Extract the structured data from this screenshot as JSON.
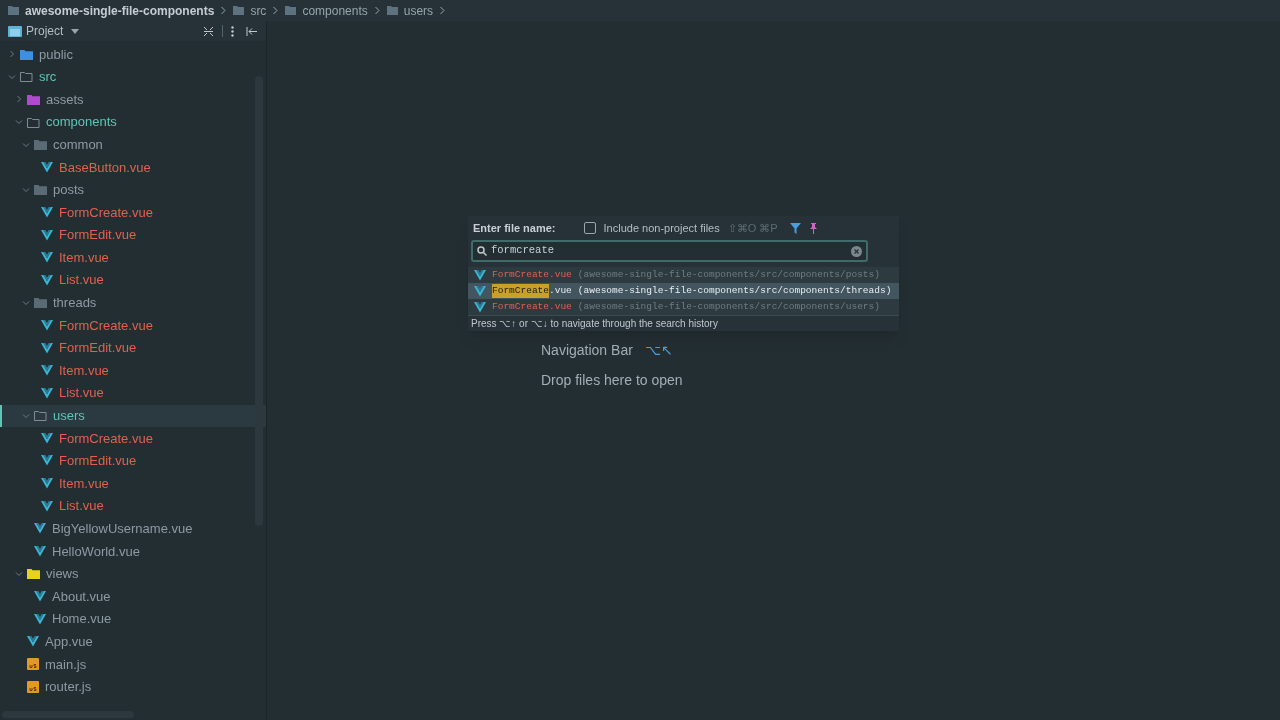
{
  "breadcrumb": [
    {
      "label": "awesome-single-file-components",
      "bold": true
    },
    {
      "label": "src",
      "bold": false
    },
    {
      "label": "components",
      "bold": false
    },
    {
      "label": "users",
      "bold": false
    }
  ],
  "panel": {
    "title": "Project"
  },
  "tree": [
    {
      "kind": "folder",
      "name": "public",
      "color": "#3d8fe0",
      "expanded": false,
      "current": false,
      "selected": false
    },
    {
      "kind": "folder",
      "name": "src",
      "expanded": true,
      "current": true,
      "selected": false,
      "children": [
        {
          "kind": "folder",
          "name": "assets",
          "color": "#b04bd0",
          "expanded": false,
          "current": false,
          "selected": false
        },
        {
          "kind": "folder",
          "name": "components",
          "expanded": true,
          "current": true,
          "selected": false,
          "children": [
            {
              "kind": "folder",
              "name": "common",
              "color": "#5b6b75",
              "expanded": true,
              "current": false,
              "selected": false,
              "children": [
                {
                  "kind": "vue",
                  "name": "BaseButton.vue",
                  "modified": true
                }
              ]
            },
            {
              "kind": "folder",
              "name": "posts",
              "color": "#5b6b75",
              "expanded": true,
              "current": false,
              "selected": false,
              "children": [
                {
                  "kind": "vue",
                  "name": "FormCreate.vue",
                  "modified": true
                },
                {
                  "kind": "vue",
                  "name": "FormEdit.vue",
                  "modified": true
                },
                {
                  "kind": "vue",
                  "name": "Item.vue",
                  "modified": true
                },
                {
                  "kind": "vue",
                  "name": "List.vue",
                  "modified": true
                }
              ]
            },
            {
              "kind": "folder",
              "name": "threads",
              "color": "#5b6b75",
              "expanded": true,
              "current": false,
              "selected": false,
              "children": [
                {
                  "kind": "vue",
                  "name": "FormCreate.vue",
                  "modified": true
                },
                {
                  "kind": "vue",
                  "name": "FormEdit.vue",
                  "modified": true
                },
                {
                  "kind": "vue",
                  "name": "Item.vue",
                  "modified": true
                },
                {
                  "kind": "vue",
                  "name": "List.vue",
                  "modified": true
                }
              ]
            },
            {
              "kind": "folder",
              "name": "users",
              "expanded": true,
              "current": true,
              "selected": true,
              "children": [
                {
                  "kind": "vue",
                  "name": "FormCreate.vue",
                  "modified": true
                },
                {
                  "kind": "vue",
                  "name": "FormEdit.vue",
                  "modified": true
                },
                {
                  "kind": "vue",
                  "name": "Item.vue",
                  "modified": true
                },
                {
                  "kind": "vue",
                  "name": "List.vue",
                  "modified": true
                }
              ]
            },
            {
              "kind": "vue",
              "name": "BigYellowUsername.vue",
              "modified": false
            },
            {
              "kind": "vue",
              "name": "HelloWorld.vue",
              "modified": false
            }
          ]
        },
        {
          "kind": "folder",
          "name": "views",
          "color": "#e8d21a",
          "expanded": true,
          "current": false,
          "selected": false,
          "children": [
            {
              "kind": "vue",
              "name": "About.vue",
              "modified": false
            },
            {
              "kind": "vue",
              "name": "Home.vue",
              "modified": false
            }
          ]
        },
        {
          "kind": "vue",
          "name": "App.vue",
          "modified": false
        },
        {
          "kind": "js",
          "name": "main.js",
          "modified": false
        },
        {
          "kind": "js",
          "name": "router.js",
          "modified": false
        }
      ]
    }
  ],
  "hints": [
    {
      "label": "Navigation Bar",
      "shortcut": "⌥↖"
    },
    {
      "label": "Drop files here to open"
    }
  ],
  "popup": {
    "label": "Enter file name:",
    "include_label": "Include non-project files",
    "include_checked": false,
    "include_shortcut": "⇧⌘O ⌘P",
    "value": "formcreate",
    "results": [
      {
        "name": "FormCreate",
        "ext": ".vue",
        "path": "(awesome-single-file-components/src/components/posts)",
        "selected": false
      },
      {
        "name": "FormCreate",
        "ext": ".vue",
        "path": "(awesome-single-file-components/src/components/threads)",
        "selected": true
      },
      {
        "name": "FormCreate",
        "ext": ".vue",
        "path": "(awesome-single-file-components/src/components/users)",
        "selected": false
      }
    ],
    "footer": "Press ⌥↑ or ⌥↓ to navigate through the search history"
  }
}
